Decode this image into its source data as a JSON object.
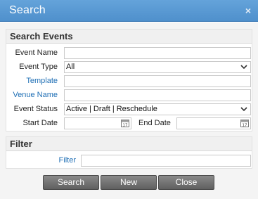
{
  "dialog": {
    "title": "Search",
    "close_glyph": "×"
  },
  "search_events": {
    "header": "Search Events",
    "event_name": {
      "label": "Event Name",
      "value": ""
    },
    "event_type": {
      "label": "Event Type",
      "value": "All"
    },
    "template": {
      "label": "Template",
      "value": ""
    },
    "venue_name": {
      "label": "Venue Name",
      "value": ""
    },
    "event_status": {
      "label": "Event Status",
      "value": "Active | Draft | Reschedule"
    },
    "start_date": {
      "label": "Start Date",
      "value": ""
    },
    "end_date": {
      "label": "End Date",
      "value": ""
    }
  },
  "filter": {
    "header": "Filter",
    "label": "Filter",
    "value": ""
  },
  "buttons": {
    "search": "Search",
    "new": "New",
    "close": "Close"
  },
  "colors": {
    "titlebar": "#5b9bd5",
    "link": "#1f6fb5",
    "button": "#6f6f6f"
  },
  "icons": {
    "dropdown": "chevron-down-icon",
    "calendar": "calendar-icon",
    "close": "close-icon"
  }
}
